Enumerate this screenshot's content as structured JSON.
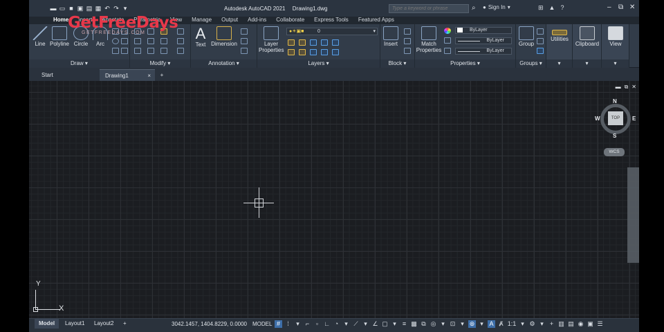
{
  "app": {
    "title": "Autodesk AutoCAD 2021",
    "document": "Drawing1.dwg"
  },
  "search": {
    "placeholder": "Type a keyword or phrase"
  },
  "user": {
    "sign_in": "Sign In"
  },
  "ribbon_tabs": [
    "Home",
    "Insert",
    "Annotate",
    "Parametric",
    "View",
    "Manage",
    "Output",
    "Add-ins",
    "Collaborate",
    "Express Tools",
    "Featured Apps"
  ],
  "ribbon": {
    "draw": {
      "label": "Draw",
      "line": "Line",
      "polyline": "Polyline",
      "circle": "Circle",
      "arc": "Arc"
    },
    "modify": {
      "label": "Modify"
    },
    "annotation": {
      "label": "Annotation",
      "text": "Text",
      "dimension": "Dimension"
    },
    "layers": {
      "label": "Layers",
      "layer_properties_1": "Layer",
      "layer_properties_2": "Properties",
      "current_layer": "0"
    },
    "block": {
      "label": "Block",
      "insert": "Insert"
    },
    "properties": {
      "label": "Properties",
      "match_1": "Match",
      "match_2": "Properties",
      "color": "ByLayer",
      "linetype": "ByLayer",
      "lineweight": "ByLayer"
    },
    "groups": {
      "label": "Groups",
      "group": "Group"
    },
    "utilities": {
      "label": "Utilities"
    },
    "clipboard": {
      "label": "Clipboard"
    },
    "view": {
      "label": "View"
    }
  },
  "file_tabs": {
    "start": "Start",
    "drawing": "Drawing1",
    "close": "×",
    "new": "+"
  },
  "viewcube": {
    "n": "N",
    "s": "S",
    "e": "E",
    "w": "W",
    "face": "TOP",
    "wcs": "WCS"
  },
  "ucs": {
    "x": "X",
    "y": "Y"
  },
  "status": {
    "layouts": [
      "Model",
      "Layout1",
      "Layout2",
      "+"
    ],
    "coordinates": "3042.1457, 1404.8229, 0.0000",
    "model": "MODEL",
    "scale": "1:1"
  },
  "watermark": {
    "brand": "GetFreeDays",
    "sub": "GETFREEDAYS.COM"
  },
  "colors": {
    "canvas": "#1b1d21",
    "ribbon": "#323c49",
    "accent": "#3d6ea8",
    "watermark": "#e8384a"
  }
}
